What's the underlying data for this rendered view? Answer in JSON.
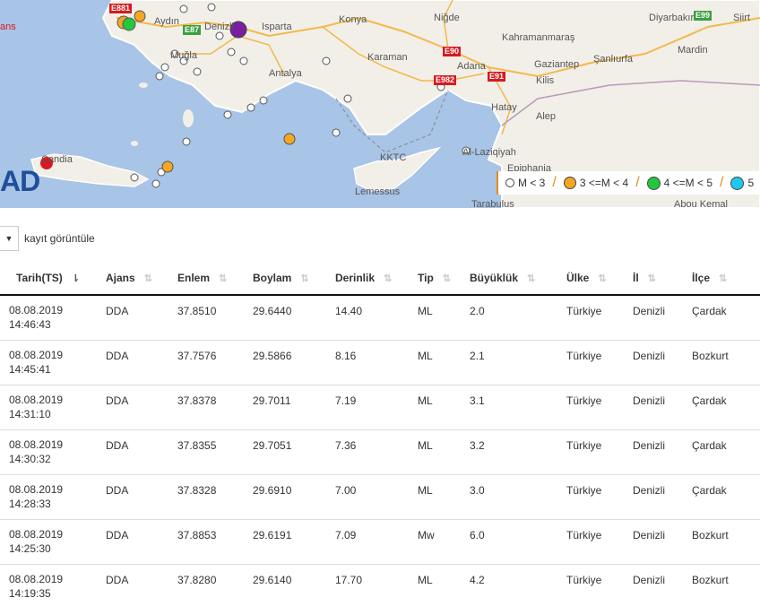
{
  "map": {
    "labels": {
      "aydin": "Aydın",
      "denizli": "Denizli",
      "isparta": "Isparta",
      "mugla": "Muğla",
      "antalya": "Antalya",
      "konya": "Konya",
      "nigde": "Niğde",
      "karaman": "Karaman",
      "kahramanmaras": "Kahramanmaraş",
      "gaziantep": "Gaziantep",
      "sanliurfa": "Şanlıurfa",
      "adana": "Adana",
      "kilis": "Kilis",
      "hatay": "Hatay",
      "halep": "Alep",
      "diyarbakir": "Diyarbakır",
      "mardin": "Mardin",
      "siirt": "Siirt",
      "alladhiqiyah": "Al-Laziqiyah",
      "kktc": "KKTC",
      "lemessus": "Lemessus",
      "kandia": "Candia",
      "tarabulus": "Tarabulus",
      "abou_kemal": "Abou Kemal",
      "finiki": "Epiphania",
      "ans": "ans"
    },
    "roads": {
      "e881": "E881",
      "e87": "E87",
      "e90": "E90",
      "e982": "E982",
      "e91": "E91",
      "e99": "E99"
    },
    "brand": "AD",
    "legend": [
      {
        "label": "M <   3",
        "color": "#ffffff",
        "size": 8
      },
      {
        "label": "3 <=M < 4",
        "color": "#f5a623",
        "size": 12
      },
      {
        "label": "4 <=M < 5",
        "color": "#22c83c",
        "size": 14
      },
      {
        "label": "5",
        "color": "#1ec8f0",
        "size": 14
      }
    ],
    "colors": {
      "sea": "#a8c4e6",
      "land": "#f2efe9",
      "coast": "#ffffff",
      "road": "#f3b94b",
      "purple": "#7a1fa2"
    }
  },
  "controls": {
    "select_value": "",
    "label": "kayıt görüntüle"
  },
  "table": {
    "columns": [
      "Tarih(TS)",
      "Ajans",
      "Enlem",
      "Boylam",
      "Derinlik",
      "Tip",
      "Büyüklük",
      "Ülke",
      "İl",
      "İlçe"
    ],
    "rows": [
      {
        "date": "08.08.2019",
        "time": "14:46:43",
        "ajans": "DDA",
        "enlem": "37.8510",
        "boylam": "29.6440",
        "derinlik": "14.40",
        "tip": "ML",
        "buyukluk": "2.0",
        "ulke": "Türkiye",
        "il": "Denizli",
        "ilce": "Çardak"
      },
      {
        "date": "08.08.2019",
        "time": "14:45:41",
        "ajans": "DDA",
        "enlem": "37.7576",
        "boylam": "29.5866",
        "derinlik": "8.16",
        "tip": "ML",
        "buyukluk": "2.1",
        "ulke": "Türkiye",
        "il": "Denizli",
        "ilce": "Bozkurt"
      },
      {
        "date": "08.08.2019",
        "time": "14:31:10",
        "ajans": "DDA",
        "enlem": "37.8378",
        "boylam": "29.7011",
        "derinlik": "7.19",
        "tip": "ML",
        "buyukluk": "3.1",
        "ulke": "Türkiye",
        "il": "Denizli",
        "ilce": "Çardak"
      },
      {
        "date": "08.08.2019",
        "time": "14:30:32",
        "ajans": "DDA",
        "enlem": "37.8355",
        "boylam": "29.7051",
        "derinlik": "7.36",
        "tip": "ML",
        "buyukluk": "3.2",
        "ulke": "Türkiye",
        "il": "Denizli",
        "ilce": "Çardak"
      },
      {
        "date": "08.08.2019",
        "time": "14:28:33",
        "ajans": "DDA",
        "enlem": "37.8328",
        "boylam": "29.6910",
        "derinlik": "7.00",
        "tip": "ML",
        "buyukluk": "3.0",
        "ulke": "Türkiye",
        "il": "Denizli",
        "ilce": "Çardak"
      },
      {
        "date": "08.08.2019",
        "time": "14:25:30",
        "ajans": "DDA",
        "enlem": "37.8853",
        "boylam": "29.6191",
        "derinlik": "7.09",
        "tip": "Mw",
        "buyukluk": "6.0",
        "ulke": "Türkiye",
        "il": "Denizli",
        "ilce": "Bozkurt"
      },
      {
        "date": "08.08.2019",
        "time": "14:19:35",
        "ajans": "DDA",
        "enlem": "37.8280",
        "boylam": "29.6140",
        "derinlik": "17.70",
        "tip": "ML",
        "buyukluk": "4.2",
        "ulke": "Türkiye",
        "il": "Denizli",
        "ilce": "Bozkurt"
      }
    ]
  }
}
